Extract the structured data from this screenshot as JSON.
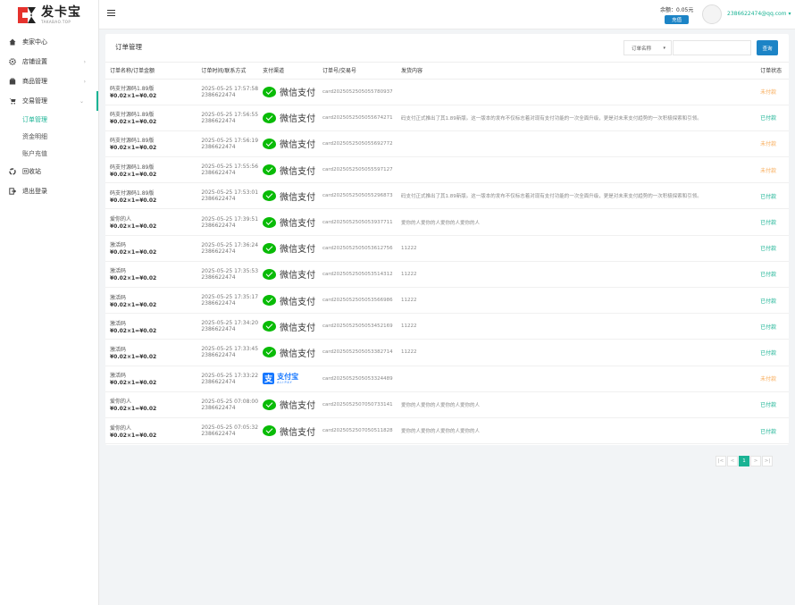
{
  "brand": {
    "name": "发卡宝",
    "sub": "TAKABAO.TOP",
    "accent": "#1ab394",
    "logo_red": "#e5322d"
  },
  "sidebar": {
    "items": [
      {
        "label": "卖家中心",
        "icon": "home-icon"
      },
      {
        "label": "店铺设置",
        "icon": "gear-icon"
      },
      {
        "label": "商品管理",
        "icon": "box-icon"
      },
      {
        "label": "交易管理",
        "icon": "cart-icon"
      }
    ],
    "sub_items": [
      {
        "label": "订单管理"
      },
      {
        "label": "资金明细"
      },
      {
        "label": "账户充值"
      }
    ],
    "bottom_items": [
      {
        "label": "回收站",
        "icon": "recycle-icon"
      },
      {
        "label": "退出登录",
        "icon": "logout-icon"
      }
    ]
  },
  "topbar": {
    "balance": "余额：0.05元",
    "recharge_label": "充值",
    "user_email": "2386622474@qq.com"
  },
  "page": {
    "title": "订单管理",
    "filter_select": "订单名称",
    "search_label": "查询"
  },
  "table": {
    "headers": [
      "订单名称/订单金额",
      "订单时间/联系方式",
      "支付渠道",
      "订单号/交易号",
      "发货内容",
      "订单状态"
    ],
    "rows": [
      {
        "name": "码支付源码1.89版",
        "amount": "¥0.02×1=¥0.02",
        "time": "2025-05-25 17:57:58",
        "contact": "2386622474",
        "pay": "微信支付",
        "pay_type": "wechat",
        "order_no": "card2025052505055780937",
        "content": "",
        "status": "未付款",
        "paid": false
      },
      {
        "name": "码支付源码1.89版",
        "amount": "¥0.02×1=¥0.02",
        "time": "2025-05-25 17:56:55",
        "contact": "2386622474",
        "pay": "微信支付",
        "pay_type": "wechat",
        "order_no": "card2025052505055674271",
        "content": "码支付正式推出了其1.89新版。这一版本的发布不仅标志着对现有支付功能的一次全面升级，更是对未来支付趋势的一次积极探索和引领。",
        "status": "已付款",
        "paid": true
      },
      {
        "name": "码支付源码1.89版",
        "amount": "¥0.02×1=¥0.02",
        "time": "2025-05-25 17:56:19",
        "contact": "2386622474",
        "pay": "微信支付",
        "pay_type": "wechat",
        "order_no": "card2025052505055692772",
        "content": "",
        "status": "未付款",
        "paid": false
      },
      {
        "name": "码支付源码1.89版",
        "amount": "¥0.02×1=¥0.02",
        "time": "2025-05-25 17:55:56",
        "contact": "2386622474",
        "pay": "微信支付",
        "pay_type": "wechat",
        "order_no": "card2025052505055597127",
        "content": "",
        "status": "未付款",
        "paid": false
      },
      {
        "name": "码支付源码1.89版",
        "amount": "¥0.02×1=¥0.02",
        "time": "2025-05-25 17:53:01",
        "contact": "2386622474",
        "pay": "微信支付",
        "pay_type": "wechat",
        "order_no": "card2025052505055296873",
        "content": "码支付正式推出了其1.89新版。这一版本的发布不仅标志着对现有支付功能的一次全面升级，更是对未来支付趋势的一次积极探索和引领。",
        "status": "已付款",
        "paid": true
      },
      {
        "name": "爱你的人",
        "amount": "¥0.02×1=¥0.02",
        "time": "2025-05-25 17:39:51",
        "contact": "2386622474",
        "pay": "微信支付",
        "pay_type": "wechat",
        "order_no": "card2025052505053937711",
        "content": "爱你的人爱你的人爱你的人爱你的人",
        "status": "已付款",
        "paid": true
      },
      {
        "name": "激活码",
        "amount": "¥0.02×1=¥0.02",
        "time": "2025-05-25 17:36:24",
        "contact": "2386622474",
        "pay": "微信支付",
        "pay_type": "wechat",
        "order_no": "card2025052505053612756",
        "content": "11222",
        "status": "已付款",
        "paid": true
      },
      {
        "name": "激活码",
        "amount": "¥0.02×1=¥0.02",
        "time": "2025-05-25 17:35:53",
        "contact": "2386622474",
        "pay": "微信支付",
        "pay_type": "wechat",
        "order_no": "card2025052505053514312",
        "content": "11222",
        "status": "已付款",
        "paid": true
      },
      {
        "name": "激活码",
        "amount": "¥0.02×1=¥0.02",
        "time": "2025-05-25 17:35:17",
        "contact": "2386622474",
        "pay": "微信支付",
        "pay_type": "wechat",
        "order_no": "card2025052505053566986",
        "content": "11222",
        "status": "已付款",
        "paid": true
      },
      {
        "name": "激活码",
        "amount": "¥0.02×1=¥0.02",
        "time": "2025-05-25 17:34:20",
        "contact": "2386622474",
        "pay": "微信支付",
        "pay_type": "wechat",
        "order_no": "card2025052505053452169",
        "content": "11222",
        "status": "已付款",
        "paid": true
      },
      {
        "name": "激活码",
        "amount": "¥0.02×1=¥0.02",
        "time": "2025-05-25 17:33:45",
        "contact": "2386622474",
        "pay": "微信支付",
        "pay_type": "wechat",
        "order_no": "card2025052505053382714",
        "content": "11222",
        "status": "已付款",
        "paid": true
      },
      {
        "name": "激活码",
        "amount": "¥0.02×1=¥0.02",
        "time": "2025-05-25 17:33:22",
        "contact": "2386622474",
        "pay": "支付宝",
        "pay_sub": "ALIPAY",
        "pay_type": "alipay",
        "order_no": "card2025052505053324489",
        "content": "",
        "status": "未付款",
        "paid": false
      },
      {
        "name": "爱你的人",
        "amount": "¥0.02×1=¥0.02",
        "time": "2025-05-25 07:08:00",
        "contact": "2386622474",
        "pay": "微信支付",
        "pay_type": "wechat",
        "order_no": "card2025052507050733141",
        "content": "爱你的人爱你的人爱你的人爱你的人",
        "status": "已付款",
        "paid": true
      },
      {
        "name": "爱你的人",
        "amount": "¥0.02×1=¥0.02",
        "time": "2025-05-25 07:05:32",
        "contact": "2386622474",
        "pay": "微信支付",
        "pay_type": "wechat",
        "order_no": "card2025052507050511828",
        "content": "爱你的人爱你的人爱你的人爱你的人",
        "status": "已付款",
        "paid": true
      }
    ]
  },
  "pager": {
    "buttons": [
      "|<",
      "<",
      "1",
      ">",
      ">|"
    ],
    "current": "1"
  }
}
